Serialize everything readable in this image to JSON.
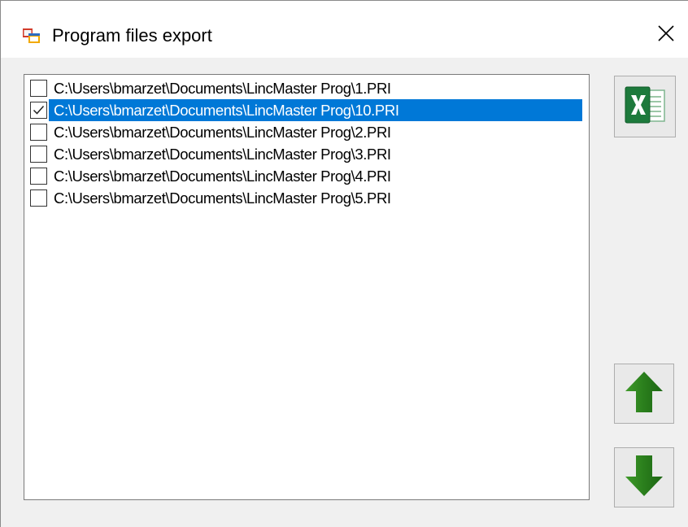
{
  "window": {
    "title": "Program files export",
    "close_glyph": "✕",
    "app_icon": "windows-form-icon"
  },
  "file_list": {
    "items": [
      {
        "path": "C:\\Users\\bmarzet\\Documents\\LincMaster Prog\\1.PRI",
        "checked": false,
        "selected": false
      },
      {
        "path": "C:\\Users\\bmarzet\\Documents\\LincMaster Prog\\10.PRI",
        "checked": true,
        "selected": true
      },
      {
        "path": "C:\\Users\\bmarzet\\Documents\\LincMaster Prog\\2.PRI",
        "checked": false,
        "selected": false
      },
      {
        "path": "C:\\Users\\bmarzet\\Documents\\LincMaster Prog\\3.PRI",
        "checked": false,
        "selected": false
      },
      {
        "path": "C:\\Users\\bmarzet\\Documents\\LincMaster Prog\\4.PRI",
        "checked": false,
        "selected": false
      },
      {
        "path": "C:\\Users\\bmarzet\\Documents\\LincMaster Prog\\5.PRI",
        "checked": false,
        "selected": false
      }
    ]
  },
  "buttons": {
    "export": {
      "icon": "excel-icon"
    },
    "move_up": {
      "icon": "arrow-up-icon"
    },
    "move_down": {
      "icon": "arrow-down-icon"
    }
  },
  "colors": {
    "selection": "#0078d7",
    "arrow_green": "#2e7d1f",
    "excel_green": "#1d7a3c"
  }
}
